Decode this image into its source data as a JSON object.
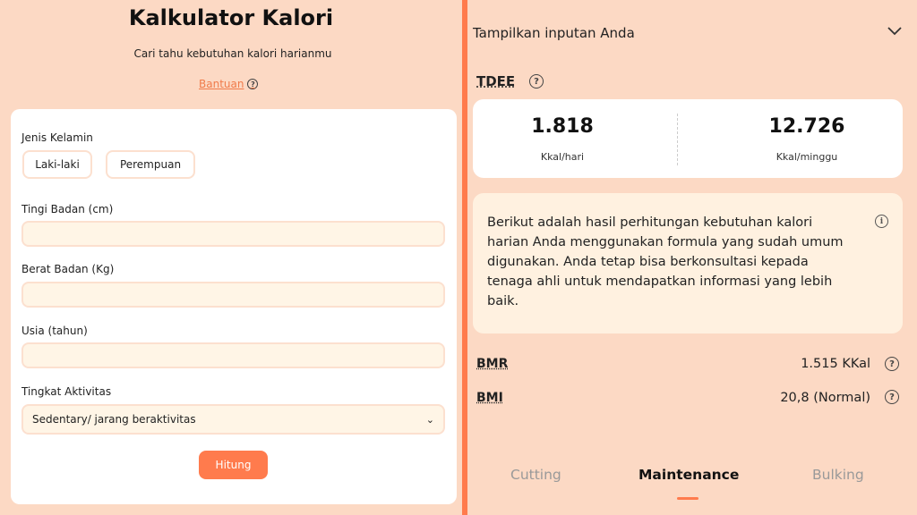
{
  "header": {
    "title": "Kalkulator Kalori",
    "subtitle": "Cari tahu kebutuhan kalori harianmu",
    "help_link": "Bantuan"
  },
  "form": {
    "gender_label": "Jenis Kelamin",
    "gender_options": [
      "Laki-laki",
      "Perempuan"
    ],
    "height_label": "Tingi Badan (cm)",
    "weight_label": "Berat Badan (Kg)",
    "age_label": "Usia (tahun)",
    "activity_label": "Tingkat Aktivitas",
    "activity_selected": "Sedentary/ jarang beraktivitas",
    "submit_label": "Hitung"
  },
  "results": {
    "toggle_label": "Tampilkan inputan Anda",
    "tdee_label": "TDEE",
    "tdee_daily": "1.818",
    "tdee_daily_unit": "Kkal/hari",
    "tdee_weekly": "12.726",
    "tdee_weekly_unit": "Kkal/minggu",
    "info_text": "Berikut adalah hasil perhitungan kebutuhan kalori harian Anda menggunakan formula yang sudah umum digunakan. Anda tetap bisa berkonsultasi kepada tenaga ahli untuk mendapatkan informasi yang lebih baik.",
    "bmr_label": "BMR",
    "bmr_value": "1.515 KKal",
    "bmi_label": "BMI",
    "bmi_value": "20,8 (Normal)"
  },
  "tabs": [
    {
      "label": "Cutting",
      "active": false
    },
    {
      "label": "Maintenance",
      "active": true
    },
    {
      "label": "Bulking",
      "active": false
    }
  ],
  "colors": {
    "background": "#fcd9c4",
    "accent": "#ff7b4d",
    "input_bg": "#fff5e6",
    "info_bg": "#fff1e0"
  }
}
